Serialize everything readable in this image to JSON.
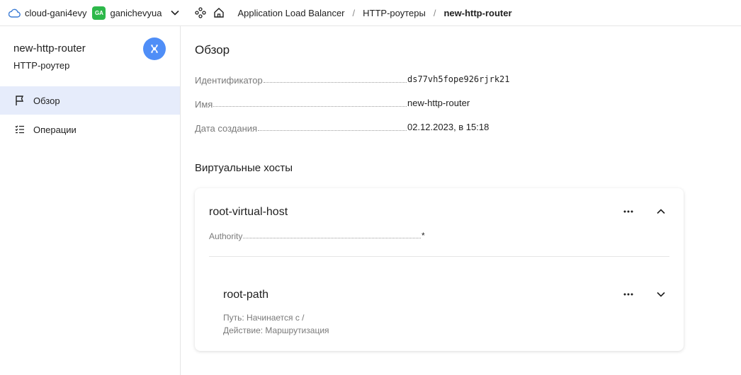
{
  "topbar": {
    "cloud_name": "cloud-gani4evy",
    "folder_badge": "GA",
    "folder_name": "ganichevyua",
    "breadcrumbs": [
      "Application Load Balancer",
      "HTTP-роутеры",
      "new-http-router"
    ],
    "separator": "/"
  },
  "sidebar": {
    "resource_name": "new-http-router",
    "resource_type": "HTTP-роутер",
    "items": [
      {
        "label": "Обзор",
        "icon": "flag-icon",
        "active": true
      },
      {
        "label": "Операции",
        "icon": "list-icon",
        "active": false
      }
    ]
  },
  "main": {
    "overview_title": "Обзор",
    "fields": [
      {
        "label": "Идентификатор",
        "value": "ds77vh5fope926rjrk21"
      },
      {
        "label": "Имя",
        "value": "new-http-router"
      },
      {
        "label": "Дата создания",
        "value": "02.12.2023, в 15:18"
      }
    ],
    "vhosts_title": "Виртуальные хосты",
    "vhost": {
      "name": "root-virtual-host",
      "authority_label": "Authority",
      "authority_value": "*",
      "route": {
        "name": "root-path",
        "path_line": "Путь: Начинается с /",
        "action_line": "Действие: Маршрутизация"
      }
    }
  },
  "colors": {
    "accent": "#4f8ef7",
    "active_nav_bg": "#e6ecfb",
    "badge_green": "#2db84a"
  }
}
